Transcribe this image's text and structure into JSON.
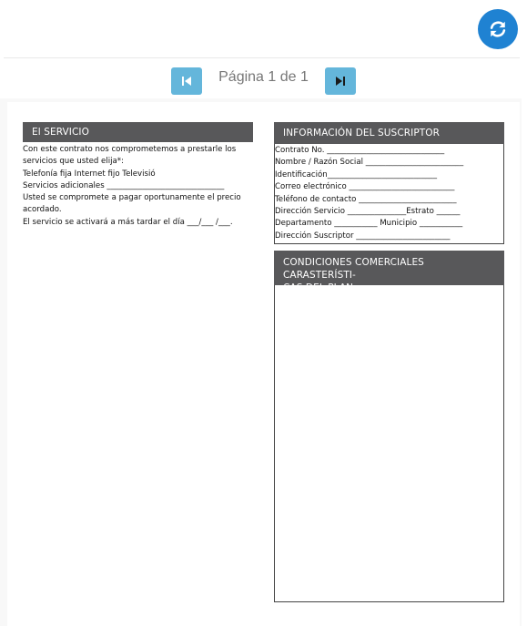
{
  "toolbar": {
    "refresh_icon": "refresh-icon"
  },
  "pager": {
    "first_icon": "skip-first-icon",
    "last_icon": "skip-last-icon",
    "label": "Página 1 de 1"
  },
  "document": {
    "servicio": {
      "title": "El SERVICIO",
      "lines": [
        "Con este contrato nos comprometemos a prestarle los",
        "servicios que usted elija*:",
        "Telefonía fija Internet fijo Televisió",
        "Servicios adicionales ______________________________",
        "Usted se compromete a pagar oportunamente el precio",
        "acordado.",
        "El servicio se activará a más tardar el día ___/___ /___."
      ]
    },
    "suscriptor": {
      "title": "INFORMACIÓN DEL SUSCRIPTOR",
      "lines": [
        "Contrato No. ______________________________",
        "Nombre / Razón Social _________________________",
        "Identificación____________________________",
        "Correo electrónico ___________________________",
        "Teléfono de contacto _________________________",
        "Dirección Servicio _______________Estrato ______",
        "Departamento ___________ Municipio ___________",
        "Dirección Suscriptor ________________________"
      ]
    },
    "condiciones": {
      "title_line1": "CONDICIONES COMERCIALES CARASTERÍSTI-",
      "title_line2": "CAS DEL PLAN"
    }
  }
}
